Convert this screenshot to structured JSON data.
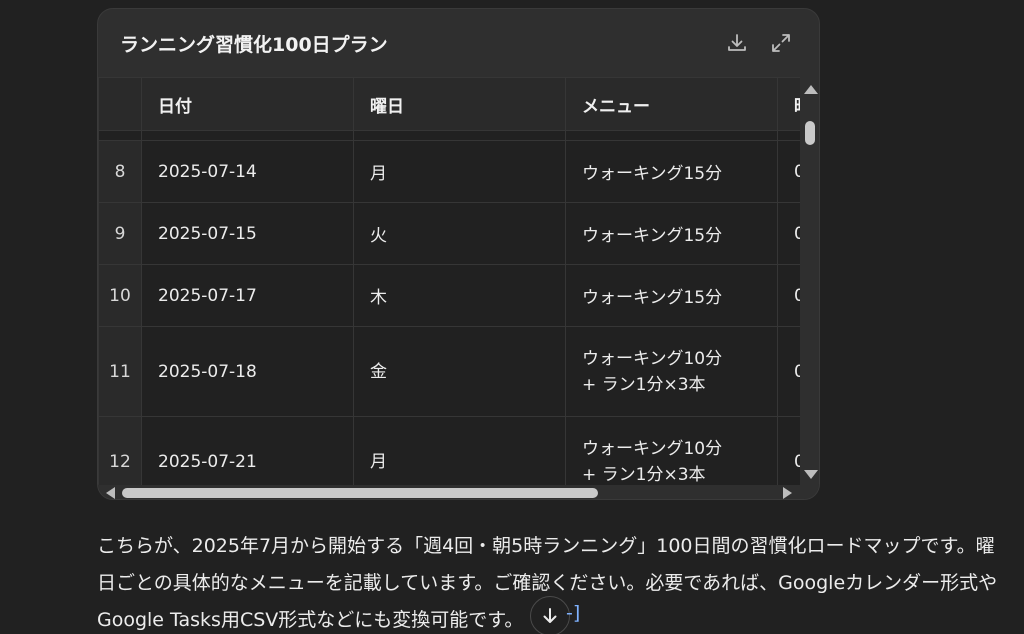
{
  "card": {
    "title": "ランニング習慣化100日プラン",
    "icons": [
      "download-icon",
      "expand-icon"
    ]
  },
  "table": {
    "headers": [
      "",
      "日付",
      "曜日",
      "メニュー",
      "時"
    ],
    "rows": [
      {
        "idx": "8",
        "date": "2025-07-14",
        "day": "月",
        "menu_1": "ウォーキング15分",
        "menu_2": "",
        "extra": "0"
      },
      {
        "idx": "9",
        "date": "2025-07-15",
        "day": "火",
        "menu_1": "ウォーキング15分",
        "menu_2": "",
        "extra": "0"
      },
      {
        "idx": "10",
        "date": "2025-07-17",
        "day": "木",
        "menu_1": "ウォーキング15分",
        "menu_2": "",
        "extra": "0"
      },
      {
        "idx": "11",
        "date": "2025-07-18",
        "day": "金",
        "menu_1": "ウォーキング10分",
        "menu_2": "+ ラン1分×3本",
        "extra": "0"
      },
      {
        "idx": "12",
        "date": "2025-07-21",
        "day": "月",
        "menu_1": "ウォーキング10分",
        "menu_2": "+ ラン1分×3本",
        "extra": "0"
      }
    ]
  },
  "message": {
    "text": "こちらが、2025年7月から開始する「週4回・朝5時ランニング」100日間の習慣化ロードマップです。曜日ごとの具体的なメニューを記載しています。ご確認ください。必要であれば、Googleカレンダー形式やGoogle Tasks用CSV形式などにも変換可能です。",
    "cite": "-]"
  }
}
